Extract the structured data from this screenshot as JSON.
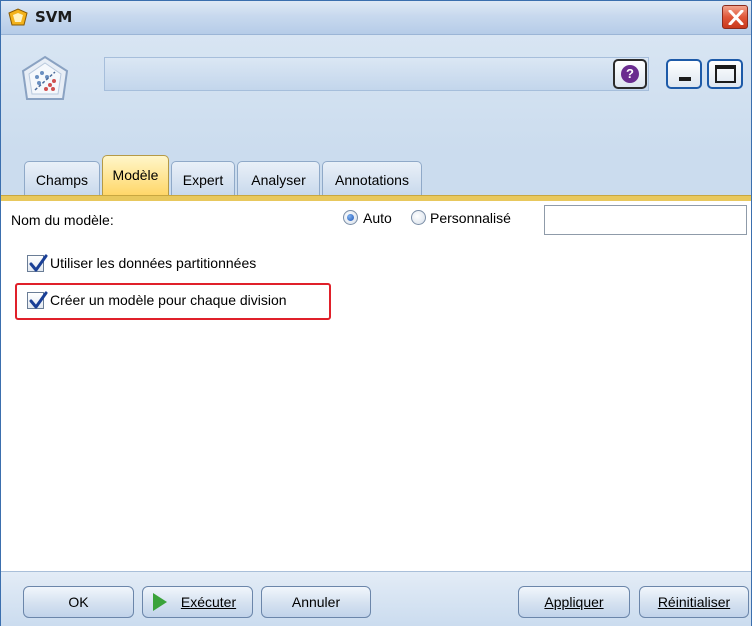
{
  "window": {
    "title": "SVM"
  },
  "header": {
    "help_label": "?"
  },
  "tabs": [
    {
      "label": "Champs",
      "active": false
    },
    {
      "label": "Modèle",
      "active": true
    },
    {
      "label": "Expert",
      "active": false
    },
    {
      "label": "Analyser",
      "active": false
    },
    {
      "label": "Annotations",
      "active": false
    }
  ],
  "form": {
    "model_name_label": "Nom du modèle:",
    "radio_auto_label": "Auto",
    "radio_custom_label": "Personnalisé",
    "radio_selected": "Auto",
    "model_name_value": "",
    "use_partitioned_label": "Utiliser les données partitionnées",
    "use_partitioned_checked": true,
    "split_model_label": "Créer un modèle pour chaque division",
    "split_model_checked": true
  },
  "footer": {
    "ok_label": "OK",
    "run_label": "Exécuter",
    "cancel_label": "Annuler",
    "apply_label": "Appliquer",
    "reset_label": "Réinitialiser"
  },
  "colors": {
    "active_tab": "#ffd769",
    "highlight_border": "#e0202a",
    "title_bar": "#c8d9ee"
  }
}
